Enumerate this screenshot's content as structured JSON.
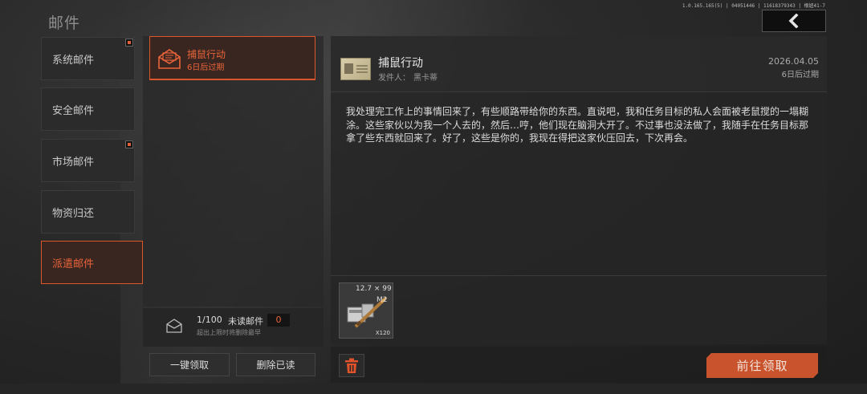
{
  "header": {
    "title": "邮件",
    "version": "1.0.165.165(5) | 04051446 | 11618379343 | 根妞41-7"
  },
  "categories": [
    {
      "label": "系统邮件",
      "has_new": true,
      "active": false
    },
    {
      "label": "安全邮件",
      "has_new": false,
      "active": false
    },
    {
      "label": "市场邮件",
      "has_new": true,
      "active": false
    },
    {
      "label": "物资归还",
      "has_new": false,
      "active": false
    },
    {
      "label": "派遣邮件",
      "has_new": false,
      "active": true
    }
  ],
  "mail_list": [
    {
      "title": "捕鼠行动",
      "expire": "6日后过期",
      "icon": "open-envelope-icon",
      "selected": true
    }
  ],
  "mailbox": {
    "count": "1/100",
    "unread_label": "未读邮件",
    "unread_count": "0",
    "note": "超出上限时将删除最早"
  },
  "list_actions": {
    "claim_all": "一键领取",
    "delete_read": "删除已读"
  },
  "mail": {
    "title": "捕鼠行动",
    "sender_label": "发件人：",
    "sender": "黑卡蒂",
    "date": "2026.04.05",
    "expire": "6日后过期",
    "body": "我处理完工作上的事情回来了，有些顺路带给你的东西。直说吧，我和任务目标的私人会面被老鼠搅的一塌糊涂。这些家伙以为我一个人去的，然后…哼，他们现在脑洞大开了。不过事也没法做了，我随手在任务目标那拿了些东西就回来了。好了，这些是你的，我现在得把这家伙压回去，下次再会。"
  },
  "attachment": {
    "caliber": "12.7 × 99",
    "model": "M2",
    "quantity": "X120",
    "icon": "ammo-box-icon"
  },
  "mail_actions": {
    "claim": "前往领取",
    "delete_icon": "trash-icon"
  },
  "colors": {
    "accent": "#e8643a",
    "accent_border": "#d9582b",
    "claim_button": "#c9532c"
  }
}
